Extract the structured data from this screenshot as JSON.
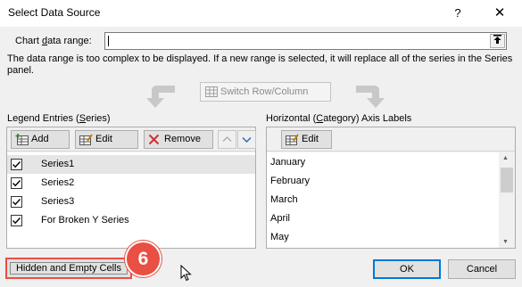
{
  "window": {
    "title": "Select Data Source",
    "help_glyph": "?",
    "close_glyph": "✕"
  },
  "range": {
    "label": "Chart data range:",
    "value": "",
    "collapse_icon": "collapse-dialog-icon"
  },
  "message": "The data range is too complex to be displayed. If a new range is selected, it will replace all of the series in the Series panel.",
  "switch_button": {
    "label": "Switch Row/Column",
    "enabled": false
  },
  "legend": {
    "header": "Legend Entries (Series)",
    "buttons": {
      "add": "Add",
      "edit": "Edit",
      "remove": "Remove"
    },
    "series": [
      {
        "label": "Series1",
        "checked": true,
        "selected": true
      },
      {
        "label": "Series2",
        "checked": true,
        "selected": false
      },
      {
        "label": "Series3",
        "checked": true,
        "selected": false
      },
      {
        "label": "For Broken Y Series",
        "checked": true,
        "selected": false
      }
    ]
  },
  "axis": {
    "header": "Horizontal (Category) Axis Labels",
    "edit_label": "Edit",
    "items": [
      "January",
      "February",
      "March",
      "April",
      "May"
    ]
  },
  "hidden_cells_button": "Hidden and Empty Cells",
  "step_badge": "6",
  "ok_label": "OK",
  "cancel_label": "Cancel",
  "colors": {
    "accent": "#0078d7",
    "highlight": "#e94f43"
  }
}
